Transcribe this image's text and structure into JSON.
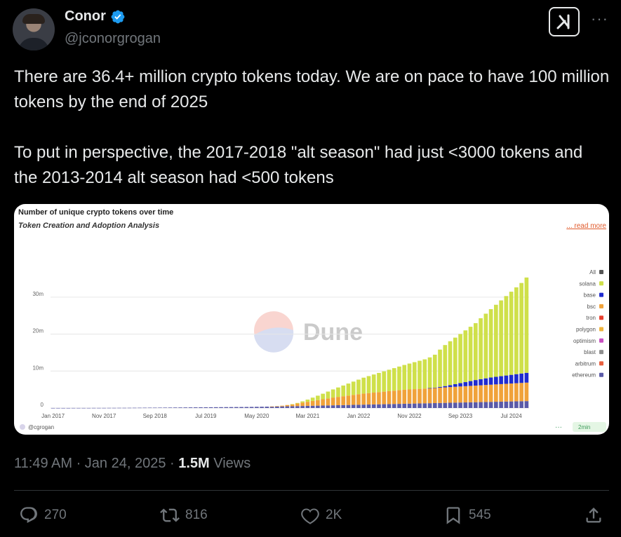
{
  "author": {
    "name": "Conor",
    "handle": "@jconorgrogan"
  },
  "tweet": {
    "line1": "There are 36.4+ million crypto tokens today. We are on pace to have 100 million tokens by the end of 2025",
    "line2": "To put in perspective, the  2017-2018 \"alt season\" had just <3000 tokens and the 2013-2014 alt season had <500 tokens"
  },
  "meta": {
    "time": "11:49 AM · Jan 24, 2025 · ",
    "views_count": "1.5M",
    "views_label": " Views"
  },
  "actions": {
    "replies": "270",
    "reposts": "816",
    "likes": "2K",
    "bookmarks": "545"
  },
  "chart_data": {
    "type": "bar",
    "stacked": true,
    "title": "Number of unique crypto tokens over time",
    "subtitle": "Token Creation and Adoption Analysis",
    "read_more": "... read more",
    "watermark": "Dune",
    "footer_user": "@cgrogan",
    "footer_badge": "2min",
    "yticks": [
      "0",
      "10m",
      "20m",
      "30m"
    ],
    "ylim": [
      0,
      37
    ],
    "xticks": [
      "Jan 2017",
      "Nov 2017",
      "Sep 2018",
      "Jul 2019",
      "May 2020",
      "Mar 2021",
      "Jan 2022",
      "Nov 2022",
      "Sep 2023",
      "Jul 2024"
    ],
    "legend": [
      "All",
      "solana",
      "base",
      "bsc",
      "tron",
      "polygon",
      "optimism",
      "blast",
      "arbitrum",
      "ethereum"
    ],
    "colors": {
      "All": "#555555",
      "solana": "#cfe04a",
      "base": "#1f2bd0",
      "bsc": "#f0a23a",
      "tron": "#e8402f",
      "polygon": "#efb43c",
      "optimism": "#c84fc0",
      "blast": "#8e8e8e",
      "arbitrum": "#e9603f",
      "ethereum": "#5a5aa8"
    },
    "x_start": "Jan 2017",
    "x_interval": "monthly",
    "series_millions": {
      "ethereum": [
        0.01,
        0.01,
        0.01,
        0.01,
        0.02,
        0.02,
        0.02,
        0.02,
        0.03,
        0.03,
        0.03,
        0.04,
        0.04,
        0.05,
        0.05,
        0.06,
        0.07,
        0.08,
        0.09,
        0.1,
        0.1,
        0.11,
        0.12,
        0.13,
        0.14,
        0.15,
        0.16,
        0.17,
        0.18,
        0.19,
        0.2,
        0.21,
        0.22,
        0.23,
        0.24,
        0.25,
        0.26,
        0.27,
        0.28,
        0.3,
        0.32,
        0.34,
        0.36,
        0.38,
        0.4,
        0.43,
        0.46,
        0.49,
        0.52,
        0.55,
        0.58,
        0.61,
        0.64,
        0.67,
        0.7,
        0.73,
        0.76,
        0.79,
        0.82,
        0.85,
        0.88,
        0.91,
        0.94,
        0.97,
        1.0,
        1.03,
        1.06,
        1.09,
        1.12,
        1.15,
        1.18,
        1.21,
        1.24,
        1.27,
        1.3,
        1.33,
        1.36,
        1.39,
        1.42,
        1.45,
        1.48,
        1.51,
        1.54,
        1.57,
        1.6,
        1.63,
        1.66,
        1.69,
        1.72,
        1.75,
        1.78,
        1.81,
        1.84,
        1.87
      ],
      "bsc": [
        0,
        0,
        0,
        0,
        0,
        0,
        0,
        0,
        0,
        0,
        0,
        0,
        0,
        0,
        0,
        0,
        0,
        0,
        0,
        0,
        0,
        0,
        0,
        0,
        0,
        0,
        0,
        0,
        0,
        0,
        0,
        0,
        0,
        0,
        0,
        0,
        0,
        0,
        0,
        0,
        0,
        0,
        0,
        0.05,
        0.1,
        0.2,
        0.35,
        0.5,
        0.7,
        0.9,
        1.1,
        1.3,
        1.5,
        1.7,
        1.9,
        2.1,
        2.25,
        2.4,
        2.55,
        2.7,
        2.85,
        3.0,
        3.1,
        3.2,
        3.3,
        3.4,
        3.5,
        3.6,
        3.7,
        3.8,
        3.85,
        3.9,
        3.95,
        4.0,
        4.05,
        4.1,
        4.15,
        4.2,
        4.25,
        4.3,
        4.35,
        4.4,
        4.45,
        4.5,
        4.55,
        4.6,
        4.65,
        4.7,
        4.75,
        4.8,
        4.85,
        4.9,
        4.95,
        5.0
      ],
      "base": [
        0,
        0,
        0,
        0,
        0,
        0,
        0,
        0,
        0,
        0,
        0,
        0,
        0,
        0,
        0,
        0,
        0,
        0,
        0,
        0,
        0,
        0,
        0,
        0,
        0,
        0,
        0,
        0,
        0,
        0,
        0,
        0,
        0,
        0,
        0,
        0,
        0,
        0,
        0,
        0,
        0,
        0,
        0,
        0,
        0,
        0,
        0,
        0,
        0,
        0,
        0,
        0,
        0,
        0,
        0,
        0,
        0,
        0,
        0,
        0,
        0,
        0,
        0,
        0,
        0,
        0,
        0,
        0,
        0,
        0,
        0,
        0,
        0,
        0,
        0.05,
        0.1,
        0.2,
        0.35,
        0.5,
        0.7,
        0.9,
        1.1,
        1.3,
        1.5,
        1.65,
        1.8,
        1.95,
        2.05,
        2.15,
        2.25,
        2.35,
        2.45,
        2.55,
        2.65
      ],
      "solana": [
        0,
        0,
        0,
        0,
        0,
        0,
        0,
        0,
        0,
        0,
        0,
        0,
        0,
        0,
        0,
        0,
        0,
        0,
        0,
        0,
        0,
        0,
        0,
        0,
        0,
        0,
        0,
        0,
        0,
        0,
        0,
        0,
        0,
        0,
        0,
        0,
        0,
        0,
        0,
        0,
        0,
        0,
        0,
        0,
        0,
        0,
        0,
        0.05,
        0.15,
        0.35,
        0.6,
        0.9,
        1.2,
        1.5,
        1.85,
        2.2,
        2.55,
        2.9,
        3.25,
        3.6,
        3.95,
        4.3,
        4.6,
        4.9,
        5.2,
        5.5,
        5.8,
        6.1,
        6.4,
        6.7,
        7.0,
        7.3,
        7.6,
        7.9,
        8.3,
        8.9,
        10.1,
        11.1,
        11.9,
        12.6,
        13.3,
        14.0,
        14.7,
        15.4,
        16.5,
        17.5,
        18.5,
        19.5,
        20.5,
        21.5,
        22.5,
        23.5,
        24.5,
        25.8
      ]
    }
  }
}
